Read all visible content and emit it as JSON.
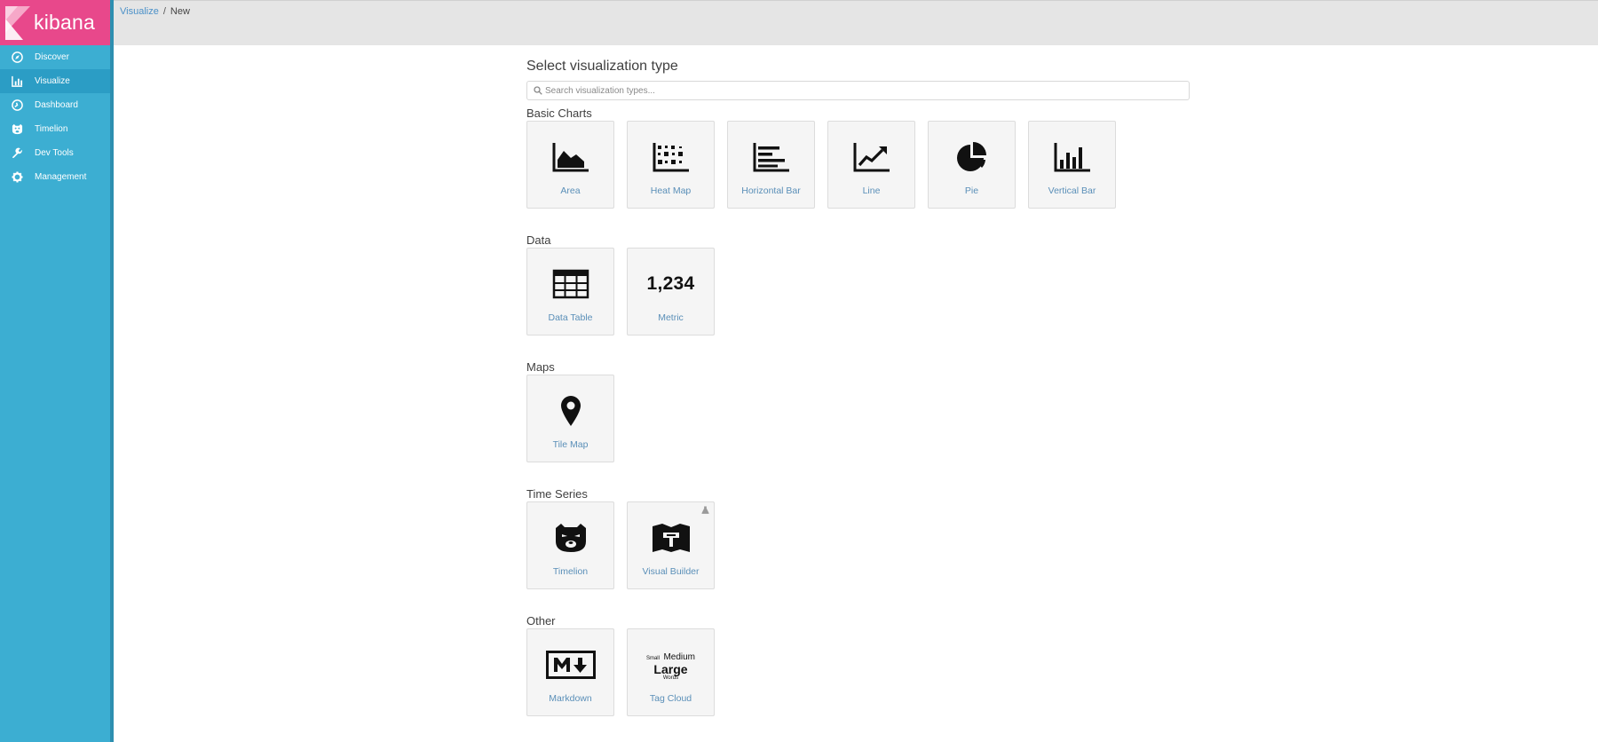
{
  "app": {
    "logo_text": "kibana",
    "brand_color": "#e8488b",
    "sidebar_color": "#3caed2"
  },
  "sidebar": {
    "items": [
      {
        "label": "Discover",
        "icon": "compass-icon"
      },
      {
        "label": "Visualize",
        "icon": "bar-chart-icon",
        "active": true
      },
      {
        "label": "Dashboard",
        "icon": "dashboard-icon"
      },
      {
        "label": "Timelion",
        "icon": "bear-icon"
      },
      {
        "label": "Dev Tools",
        "icon": "wrench-icon"
      },
      {
        "label": "Management",
        "icon": "gear-icon"
      }
    ]
  },
  "breadcrumb": {
    "parent": "Visualize",
    "separator": "/",
    "current": "New"
  },
  "main": {
    "title": "Select visualization type",
    "search": {
      "placeholder": "Search visualization types...",
      "value": ""
    },
    "sections": [
      {
        "title": "Basic Charts",
        "cards": [
          {
            "label": "Area",
            "icon": "area-chart-icon"
          },
          {
            "label": "Heat Map",
            "icon": "heat-map-icon"
          },
          {
            "label": "Horizontal Bar",
            "icon": "horizontal-bar-icon"
          },
          {
            "label": "Line",
            "icon": "line-chart-icon"
          },
          {
            "label": "Pie",
            "icon": "pie-chart-icon"
          },
          {
            "label": "Vertical Bar",
            "icon": "vertical-bar-icon"
          }
        ]
      },
      {
        "title": "Data",
        "cards": [
          {
            "label": "Data Table",
            "icon": "table-icon"
          },
          {
            "label": "Metric",
            "icon": "metric-icon",
            "icon_text": "1,234"
          }
        ]
      },
      {
        "title": "Maps",
        "cards": [
          {
            "label": "Tile Map",
            "icon": "map-pin-icon"
          }
        ]
      },
      {
        "title": "Time Series",
        "cards": [
          {
            "label": "Timelion",
            "icon": "bear-icon"
          },
          {
            "label": "Visual Builder",
            "icon": "visual-builder-icon",
            "badge": "experimental-icon"
          }
        ]
      },
      {
        "title": "Other",
        "cards": [
          {
            "label": "Markdown",
            "icon": "markdown-icon"
          },
          {
            "label": "Tag Cloud",
            "icon": "tag-cloud-icon",
            "icon_words": [
              "Small",
              "Medium",
              "Large",
              "Words"
            ]
          }
        ]
      }
    ]
  }
}
